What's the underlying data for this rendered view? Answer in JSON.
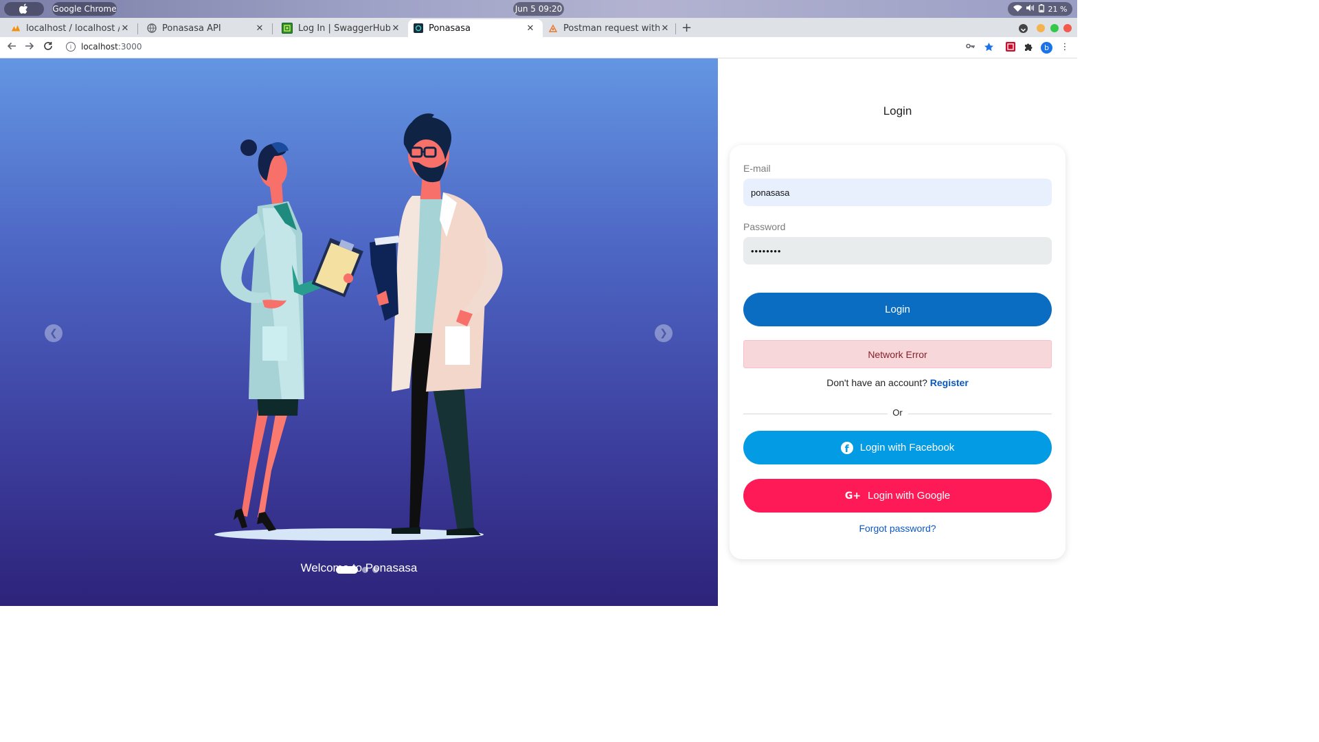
{
  "os": {
    "app_name": "Google Chrome",
    "clock": "Jun 5  09:20",
    "battery": "21 %"
  },
  "tabs": [
    {
      "title": "localhost / localhost / hot",
      "favicon": "phpmyadmin-icon",
      "active": false
    },
    {
      "title": "Ponasasa API",
      "favicon": "globe-icon",
      "active": false
    },
    {
      "title": "Log In | SwaggerHub",
      "favicon": "swaggerhub-icon",
      "active": false
    },
    {
      "title": "Ponasasa",
      "favicon": "ponasasa-icon",
      "active": true
    },
    {
      "title": "Postman request with 'gl",
      "favicon": "postman-icon",
      "active": false
    }
  ],
  "toolbar": {
    "url_host": "localhost",
    "url_port": ":3000",
    "profile_initial": "b"
  },
  "hero": {
    "caption": "Welcome to Ponasasa",
    "slides_count": 3,
    "active_slide": 1
  },
  "login": {
    "title": "Login",
    "email_label": "E-mail",
    "email_value": "ponasasa",
    "password_label": "Password",
    "password_value": "••••••••",
    "login_button": "Login",
    "error_message": "Network Error",
    "no_account_text": "Don't have an account?",
    "register_link": "Register",
    "or_text": "Or",
    "facebook_button": "Login with Facebook",
    "google_button": "Login with Google",
    "forgot_link": "Forgot password?"
  },
  "colors": {
    "login_button": "#0a6dc1",
    "facebook_button": "#049be5",
    "google_button": "#fd1a56",
    "error_bg": "#f8d7da",
    "link": "#0a57c2"
  }
}
